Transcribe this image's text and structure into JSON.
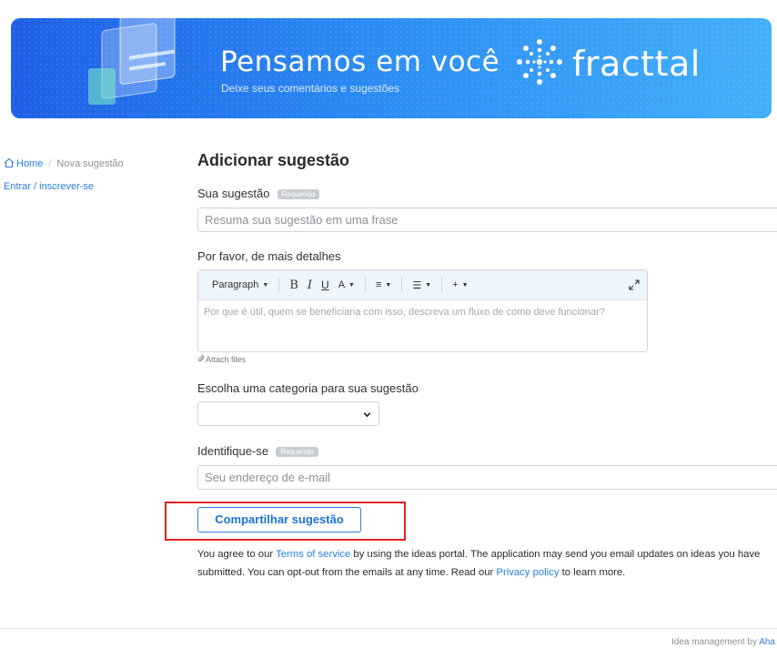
{
  "banner": {
    "title": "Pensamos em você",
    "subtitle": "Deixe seus comentários e sugestões",
    "brand": "fracttal"
  },
  "sidebar": {
    "breadcrumb_home": "Home",
    "breadcrumb_separator": "/",
    "breadcrumb_current": "Nova sugestão",
    "login_link": "Entrar / inscrever-se"
  },
  "form": {
    "title": "Adicionar sugestão",
    "suggestion_label": "Sua sugestão",
    "required_badge": "Requerido",
    "suggestion_placeholder": "Resuma sua sugestão em uma frase",
    "details_label": "Por favor, de mais detalhes",
    "details_placeholder": "Por que é útil, quem se beneficiaria com isso, descreva um fluxo de como deve funcionar?",
    "attach_label": "Attach files",
    "category_label": "Escolha uma categoria para sua sugestão",
    "category_value": "",
    "identify_label": "Identifique-se",
    "email_placeholder": "Seu endereço de e-mail",
    "submit_label": "Compartilhar sugestão"
  },
  "toolbar": {
    "paragraph": "Paragraph",
    "bold": "B",
    "italic": "I",
    "underline": "U",
    "text_color": "A",
    "align": "≡",
    "list": "☰",
    "insert": "+"
  },
  "consent": {
    "part1": "You agree to our ",
    "terms_link": "Terms of service",
    "part2": " by using the ideas portal. The application may send you email updates on ideas you have submitted. You can opt-out from the emails at any time. Read our ",
    "privacy_link": "Privacy policy",
    "part3": " to learn more."
  },
  "footer": {
    "text": "Idea management by ",
    "link": "Aha"
  },
  "colors": {
    "accent": "#2a7de1",
    "highlight": "#e02020",
    "banner_start": "#1f5fe6",
    "banner_end": "#43b0fb"
  },
  "icons": [
    "home-icon",
    "bold-icon",
    "italic-icon",
    "underline-icon",
    "text-color-icon",
    "align-icon",
    "list-icon",
    "insert-icon",
    "expand-icon",
    "paperclip-icon",
    "chevron-down-icon",
    "fracttal-logo-icon"
  ]
}
